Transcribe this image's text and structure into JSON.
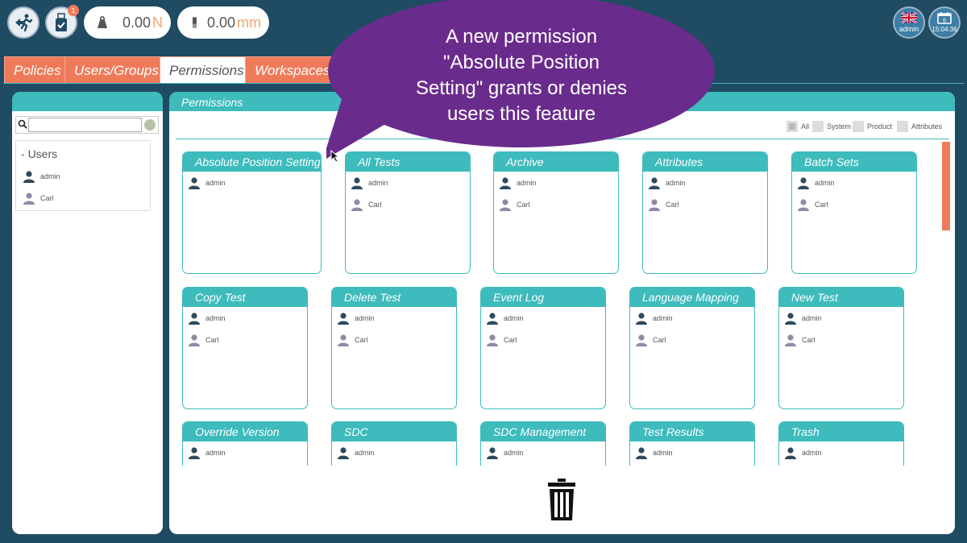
{
  "topbar": {
    "notification_count": "1",
    "force": {
      "value": "0.00",
      "unit": "N"
    },
    "position": {
      "value": "0.00",
      "unit": "mm"
    },
    "user_label": "admin",
    "clock": "15:04:36",
    "calendar_day": "6"
  },
  "tabs": [
    {
      "label": "Policies",
      "active": false
    },
    {
      "label": "Users/Groups",
      "active": false
    },
    {
      "label": "Permissions",
      "active": true
    },
    {
      "label": "Workspaces",
      "active": false
    }
  ],
  "sidebar": {
    "search_placeholder": "",
    "root_label": "Users",
    "users": [
      "admin",
      "Carl"
    ]
  },
  "permissions_panel": {
    "title": "Permissions",
    "filters": [
      "All",
      "System",
      "Product",
      "Attributes"
    ],
    "cards": [
      {
        "title": "Absolute Position Setting",
        "users": [
          "admin"
        ]
      },
      {
        "title": "All Tests",
        "users": [
          "admin",
          "Carl"
        ]
      },
      {
        "title": "Archive",
        "users": [
          "admin",
          "Carl"
        ]
      },
      {
        "title": "Attributes",
        "users": [
          "admin",
          "Carl"
        ]
      },
      {
        "title": "Batch Sets",
        "users": [
          "admin",
          "Carl"
        ]
      },
      {
        "title": "Copy Test",
        "users": [
          "admin",
          "Carl"
        ]
      },
      {
        "title": "Delete Test",
        "users": [
          "admin",
          "Carl"
        ]
      },
      {
        "title": "Event Log",
        "users": [
          "admin",
          "Carl"
        ]
      },
      {
        "title": "Language Mapping",
        "users": [
          "admin",
          "Carl"
        ]
      },
      {
        "title": "New Test",
        "users": [
          "admin",
          "Carl"
        ]
      },
      {
        "title": "Override Version",
        "users": [
          "admin"
        ]
      },
      {
        "title": "SDC",
        "users": [
          "admin"
        ]
      },
      {
        "title": "SDC Management",
        "users": [
          "admin"
        ]
      },
      {
        "title": "Test Results",
        "users": [
          "admin"
        ]
      },
      {
        "title": "Trash",
        "users": [
          "admin"
        ]
      }
    ]
  },
  "callout": {
    "lines": [
      "A new permission",
      "\"Absolute Position",
      "Setting\" grants or denies",
      "users this feature"
    ]
  },
  "colors": {
    "background": "#1f4b63",
    "accent_teal": "#3ebbbc",
    "accent_orange": "#ef7a5a",
    "callout_purple": "#6a2c8c",
    "admin_icon": "#2f4a5e",
    "user_icon": "#8f8aa8"
  },
  "icons": {
    "exit": "exit-run-icon",
    "usb": "usb-drive-icon",
    "weight": "weight-icon",
    "ruler": "length-icon",
    "flag": "uk-flag-icon",
    "calendar": "calendar-icon",
    "trash": "trash-icon"
  }
}
